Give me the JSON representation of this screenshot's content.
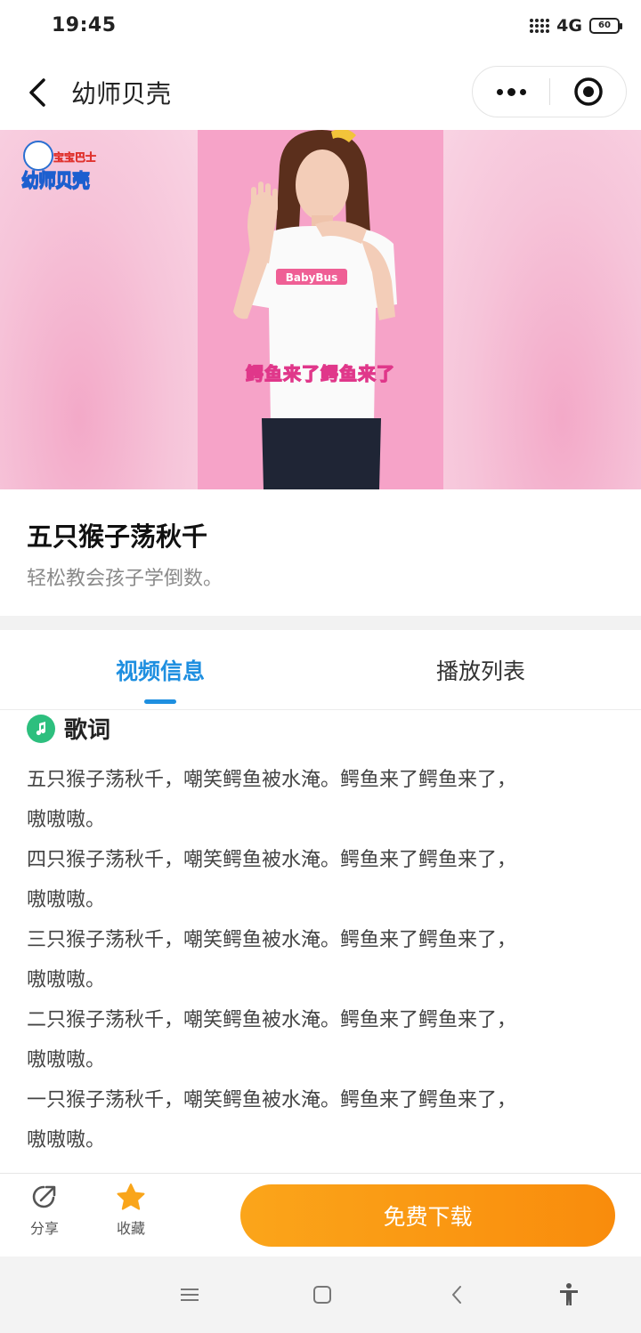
{
  "status_bar": {
    "time": "19:45",
    "network": "4G",
    "battery": "60"
  },
  "nav": {
    "title": "幼师贝壳",
    "back_icon": "chevron-left-icon",
    "more_icon": "more-dots-icon",
    "close_icon": "target-circle-icon"
  },
  "banner": {
    "logo_small": "宝宝巴士",
    "logo_text": "幼师贝壳",
    "subtitle": "鳄鱼来了鳄鱼来了"
  },
  "video": {
    "title": "五只猴子荡秋千",
    "description": "轻松教会孩子学倒数。"
  },
  "tabs": [
    {
      "label": "视频信息",
      "active": true
    },
    {
      "label": "播放列表",
      "active": false
    }
  ],
  "lyrics": {
    "heading": "歌词",
    "lines": [
      "五只猴子荡秋千，嘲笑鳄鱼被水淹。鳄鱼来了鳄鱼来了，",
      "嗷嗷嗷。",
      "四只猴子荡秋千，嘲笑鳄鱼被水淹。鳄鱼来了鳄鱼来了，",
      "嗷嗷嗷。",
      "三只猴子荡秋千，嘲笑鳄鱼被水淹。鳄鱼来了鳄鱼来了，",
      "嗷嗷嗷。",
      "二只猴子荡秋千，嘲笑鳄鱼被水淹。鳄鱼来了鳄鱼来了，",
      "嗷嗷嗷。",
      "一只猴子荡秋千，嘲笑鳄鱼被水淹。鳄鱼来了鳄鱼来了，",
      "嗷嗷嗷。"
    ]
  },
  "actions": {
    "share_label": "分享",
    "favorite_label": "收藏",
    "download_label": "免费下载"
  },
  "colors": {
    "accent_blue": "#1e8fe0",
    "download_orange": "#f98c0c",
    "favorite_star": "#f9a51a",
    "music_green": "#2dbf7e"
  }
}
